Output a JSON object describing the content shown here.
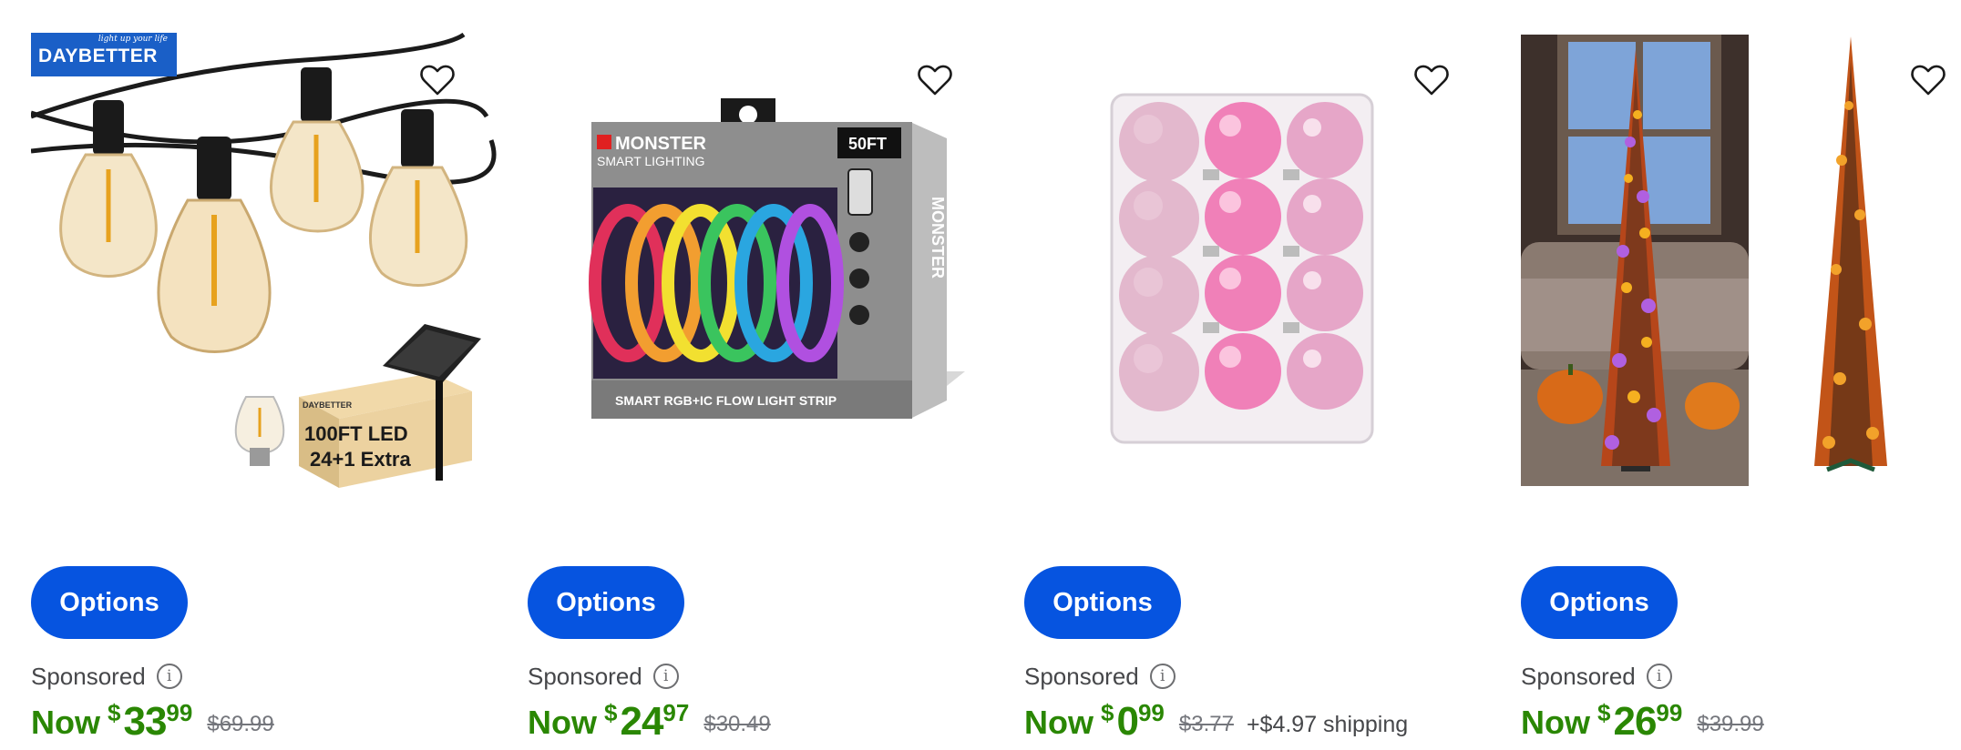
{
  "colors": {
    "accent": "#0654e0",
    "price_green": "#2a8703",
    "muted": "#74767c"
  },
  "products": [
    {
      "image_desc": "Daybetter solar string lights",
      "brand_badge_tagline": "light up your life",
      "brand_badge": "DAYBETTER",
      "box_brand": "DAYBETTER",
      "box_line1": "100FT LED",
      "box_line2": "24+1 Extra",
      "favorite_icon": "heart-outline-icon",
      "options_label": "Options",
      "sponsored_label": "Sponsored",
      "info_icon": "info-icon",
      "now_label": "Now",
      "currency": "$",
      "price_dollars": "33",
      "price_cents": "99",
      "was_price": "$69.99",
      "shipping": ""
    },
    {
      "image_desc": "Monster smart lighting LED strip box",
      "box_brand": "MONSTER",
      "box_sub": "SMART LIGHTING",
      "box_badge": "50FT",
      "box_caption": "SMART RGB+IC FLOW LIGHT STRIP",
      "favorite_icon": "heart-outline-icon",
      "options_label": "Options",
      "sponsored_label": "Sponsored",
      "info_icon": "info-icon",
      "now_label": "Now",
      "currency": "$",
      "price_dollars": "24",
      "price_cents": "97",
      "was_price": "$30.49",
      "shipping": ""
    },
    {
      "image_desc": "Pink Christmas ball ornaments in clear box",
      "favorite_icon": "heart-outline-icon",
      "options_label": "Options",
      "sponsored_label": "Sponsored",
      "info_icon": "info-icon",
      "now_label": "Now",
      "currency": "$",
      "price_dollars": "0",
      "price_cents": "99",
      "was_price": "$3.77",
      "shipping": "+$4.97 shipping"
    },
    {
      "image_desc": "Halloween pencil tree with lights",
      "favorite_icon": "heart-outline-icon",
      "options_label": "Options",
      "sponsored_label": "Sponsored",
      "info_icon": "info-icon",
      "now_label": "Now",
      "currency": "$",
      "price_dollars": "26",
      "price_cents": "99",
      "was_price": "$39.99",
      "shipping": ""
    }
  ]
}
